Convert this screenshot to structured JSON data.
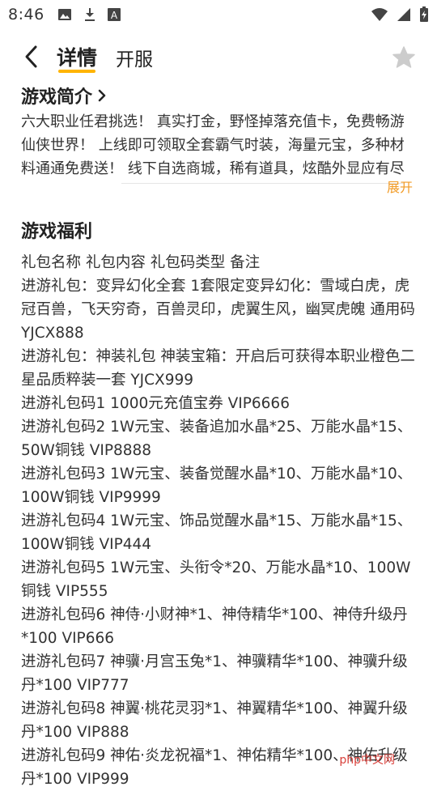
{
  "status_bar": {
    "time": "8:46",
    "left_icons": [
      "image-icon",
      "download-icon",
      "font-icon"
    ],
    "right_icons": [
      "wifi-icon",
      "signal-icon",
      "battery-icon"
    ]
  },
  "header": {
    "tabs": [
      {
        "label": "详情",
        "active": true
      },
      {
        "label": "开服",
        "active": false
      }
    ],
    "accent_color": "#ffb400"
  },
  "intro": {
    "title": "游戏简介",
    "body": "六大职业任君挑选！ 真实打金，野怪掉落充值卡，免费畅游仙侠世界！ 上线即可领取全套霸气时装，海量元宝，多种材料通通免费送！ 线下自选商城，稀有道具，炫酷外显应有尽",
    "expand_label": "展开",
    "expand_color": "#f29b26"
  },
  "welfare": {
    "title": "游戏福利",
    "lines": [
      "礼包名称 礼包内容 礼包码类型 备注",
      "进游礼包：变异幻化全套 1套限定变异幻化：雪域白虎，虎冠百兽，飞天穷奇，百兽灵印，虎翼生风，幽冥虎魄 通用码 YJCX888",
      "进游礼包：神装礼包 神装宝箱：开启后可获得本职业橙色二星品质粹装一套 YJCX999",
      "进游礼包码1 1000元充值宝券 VIP6666",
      "进游礼包码2 1W元宝、装备追加水晶*25、万能水晶*15、50W铜钱 VIP8888",
      "进游礼包码3 1W元宝、装备觉醒水晶*10、万能水晶*10、100W铜钱 VIP9999",
      "进游礼包码4 1W元宝、饰品觉醒水晶*15、万能水晶*15、100W铜钱 VIP444",
      "进游礼包码5 1W元宝、头衔令*20、万能水晶*10、100W铜钱 VIP555",
      "进游礼包码6 神侍·小财神*1、神侍精华*100、神侍升级丹*100 VIP666",
      "进游礼包码7 神骥·月宫玉兔*1、神骥精华*100、神骥升级丹*100 VIP777",
      "进游礼包码8 神翼·桃花灵羽*1、神翼精华*100、神翼升级丹*100 VIP888",
      "进游礼包码9 神佑·炎龙祝福*1、神佑精华*100、神佑升级丹*100 VIP999"
    ]
  },
  "watermark": "php中文网"
}
